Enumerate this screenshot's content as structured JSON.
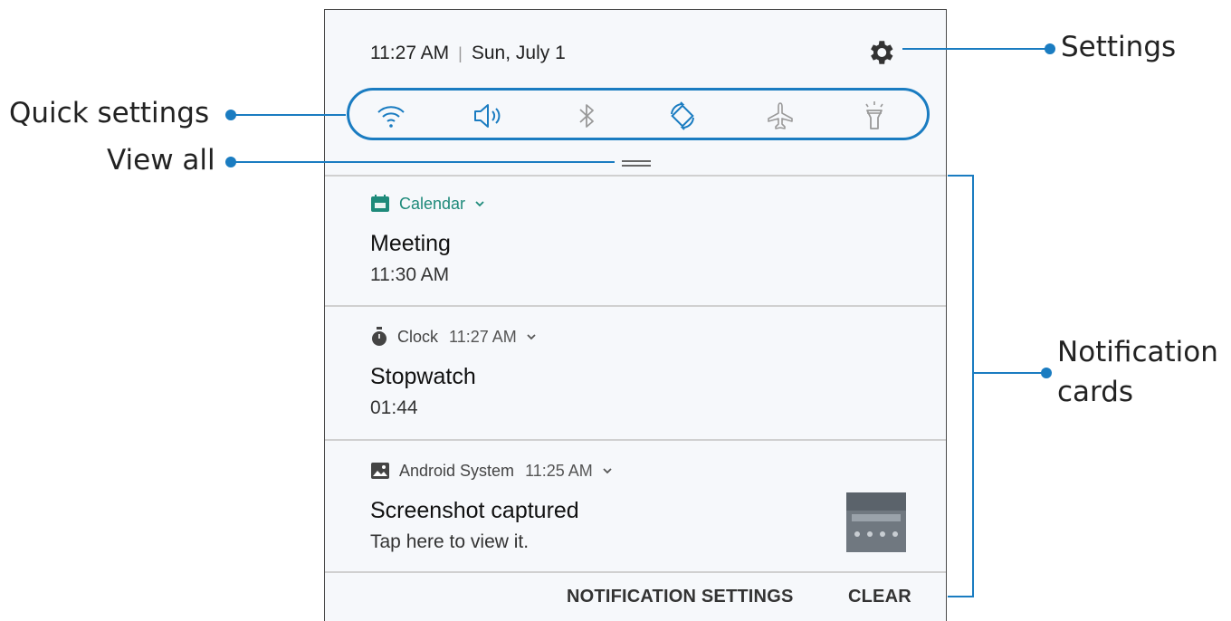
{
  "status_bar": {
    "time": "11:27 AM",
    "separator": "|",
    "date": "Sun, July 1"
  },
  "quick_settings": [
    {
      "name": "wifi-icon"
    },
    {
      "name": "sound-icon"
    },
    {
      "name": "bluetooth-icon"
    },
    {
      "name": "auto-rotate-icon"
    },
    {
      "name": "airplane-mode-icon"
    },
    {
      "name": "flashlight-icon"
    }
  ],
  "notifications": [
    {
      "app": "Calendar",
      "time": "",
      "title": "Meeting",
      "text": "11:30 AM",
      "icon": "calendar-icon"
    },
    {
      "app": "Clock",
      "time": "11:27 AM",
      "title": "Stopwatch",
      "text": "01:44",
      "icon": "stopwatch-icon"
    },
    {
      "app": "Android System",
      "time": "11:25 AM",
      "title": "Screenshot captured",
      "text": "Tap here to view it.",
      "icon": "image-icon"
    }
  ],
  "footer": {
    "settings_label": "NOTIFICATION SETTINGS",
    "clear_label": "CLEAR"
  },
  "callouts": {
    "settings": "Settings",
    "quick_settings": "Quick settings",
    "view_all": "View all",
    "notification_cards_line1": "Notification",
    "notification_cards_line2": "cards"
  },
  "colors": {
    "accent": "#1a7cc1",
    "panel_bg": "#f6f8fb",
    "calendar_green": "#1e8a7a"
  }
}
